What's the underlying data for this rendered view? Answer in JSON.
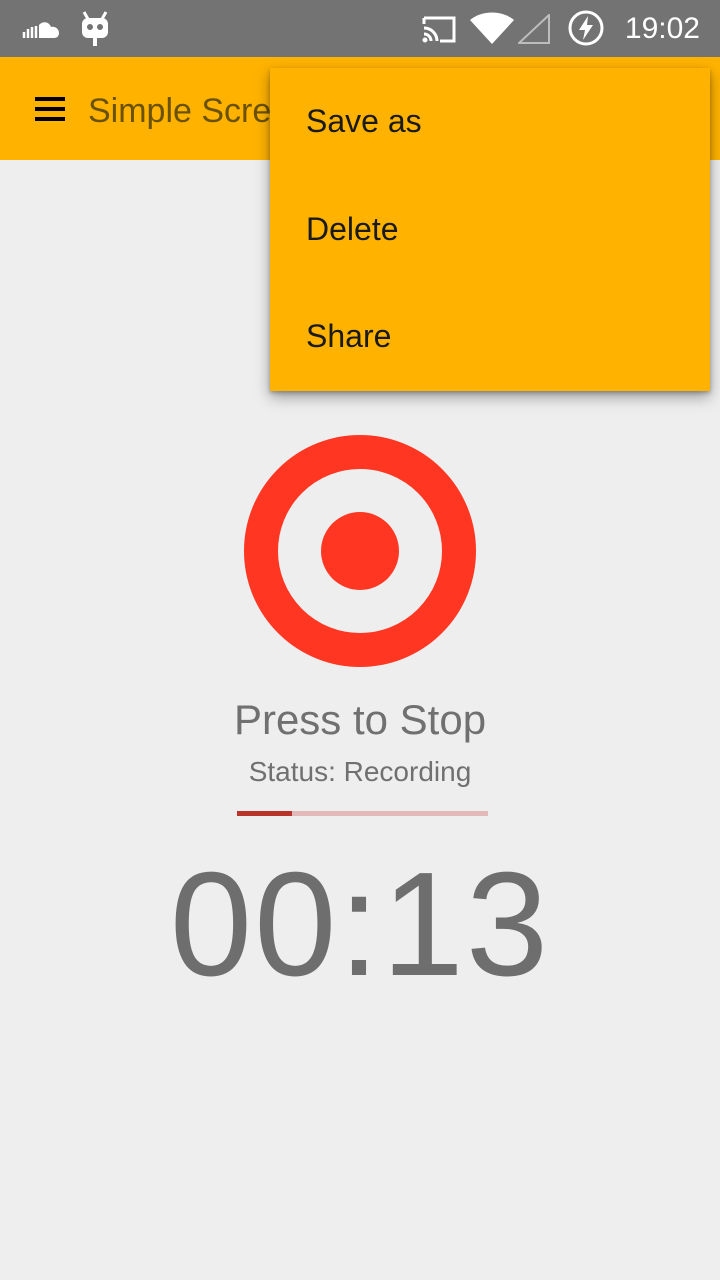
{
  "status_bar": {
    "time": "19:02",
    "icons": [
      "cloud-icon",
      "android-icon",
      "cast-icon",
      "wifi-icon",
      "signal-icon",
      "battery-charging-icon"
    ]
  },
  "app_bar": {
    "title": "Simple Scre",
    "menu_icon": "hamburger-menu-icon"
  },
  "overflow_menu": {
    "items": [
      {
        "label": "Save as"
      },
      {
        "label": "Delete"
      },
      {
        "label": "Share"
      }
    ]
  },
  "recorder": {
    "action_label": "Press to Stop",
    "status_text": "Status: Recording",
    "progress_fraction": 0.22,
    "elapsed": "00:13",
    "record_color": "#ff3722"
  },
  "colors": {
    "accent": "#ffb300",
    "status_bar": "#737373",
    "background": "#eeeeee",
    "progress_fill": "#b8342a",
    "progress_track": "#e2b9b9"
  }
}
